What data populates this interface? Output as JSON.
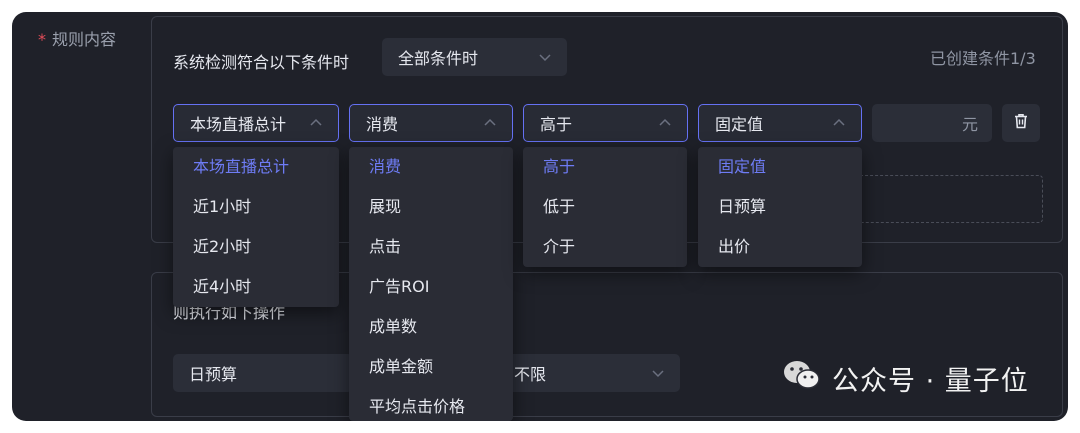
{
  "rule": {
    "label": "规则内容",
    "required_mark": "*"
  },
  "condition": {
    "prefix_text": "系统检测符合以下条件时",
    "match_select": "全部条件时",
    "created_count": "已创建条件1/3"
  },
  "row": {
    "scope_select": "本场直播总计",
    "metric_select": "消费",
    "compare_select": "高于",
    "value_type_select": "固定值",
    "unit": "元"
  },
  "dropdowns": {
    "scope": [
      "本场直播总计",
      "近1小时",
      "近2小时",
      "近4小时"
    ],
    "metric": [
      "消费",
      "展现",
      "点击",
      "广告ROI",
      "成单数",
      "成单金额",
      "平均点击价格"
    ],
    "compare": [
      "高于",
      "低于",
      "介于"
    ],
    "value_type": [
      "固定值",
      "日预算",
      "出价"
    ]
  },
  "action": {
    "text": "则执行如下操作",
    "budget_select": "日预算",
    "limit_select": "不限"
  },
  "watermark": {
    "text": "公众号 · 量子位"
  },
  "colors": {
    "background": "#1f2129",
    "accent": "#6e7cf5",
    "required": "#e34d59"
  }
}
